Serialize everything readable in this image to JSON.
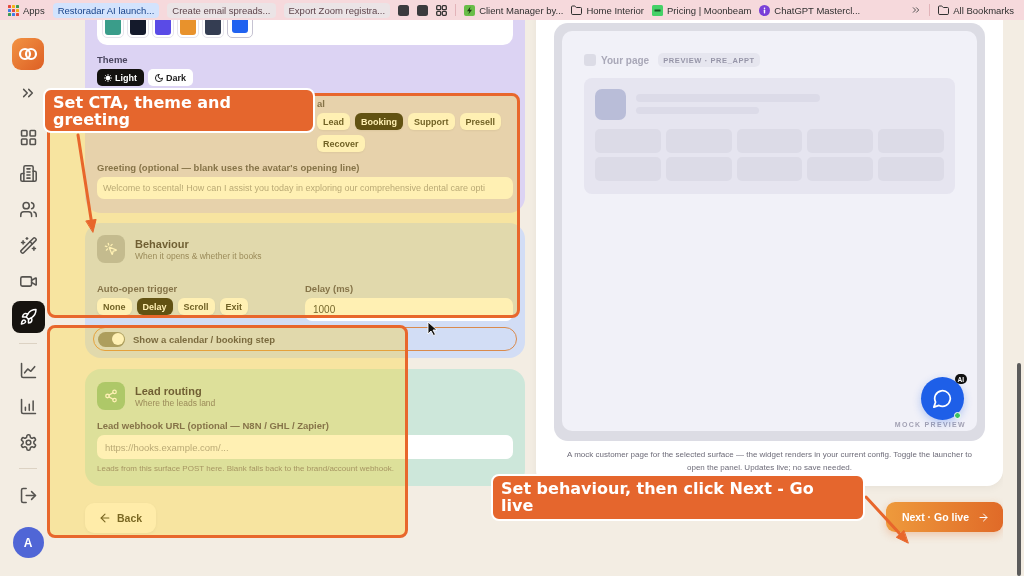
{
  "bookmarks_bar": {
    "apps_label": "Apps",
    "tab_groups": [
      {
        "label": "Restoradar AI launch...",
        "color": "#d3e3fd"
      },
      {
        "label": "Create email spreads...",
        "color": "#ebe4e6"
      },
      {
        "label": "Export Zoom registra...",
        "color": "#ebe4e6"
      }
    ],
    "bookmarks": [
      {
        "label": "Client Manager by...",
        "kind": "page"
      },
      {
        "label": "Home Interior",
        "kind": "folder"
      },
      {
        "label": "Pricing | Moonbeam",
        "kind": "page"
      },
      {
        "label": "ChatGPT Mastercl...",
        "kind": "page"
      }
    ],
    "all_bookmarks": "All Bookmarks"
  },
  "sidebar": {
    "nav_groups": [
      {
        "items": [
          {
            "selected": false
          },
          {
            "selected": false
          },
          {
            "selected": false
          },
          {
            "selected": false
          },
          {
            "selected": false
          },
          {
            "selected": true
          }
        ]
      },
      {
        "items": [
          {
            "selected": false
          },
          {
            "selected": false
          },
          {
            "selected": false
          }
        ]
      }
    ],
    "avatar_initial": "A"
  },
  "appearance_card": {
    "swatches": [
      {
        "color": "#3a9d8a",
        "selected": false
      },
      {
        "color": "#141a2b",
        "selected": false
      },
      {
        "color": "#5a4be6",
        "selected": false
      },
      {
        "color": "#e8922c",
        "selected": false
      },
      {
        "color": "#343d52",
        "selected": false
      },
      {
        "color": "#2062f0",
        "selected": true
      }
    ],
    "theme_label": "Theme",
    "themes": [
      {
        "label": "Light",
        "kind": "sun",
        "selected": true
      },
      {
        "label": "Dark",
        "kind": "moon",
        "selected": false
      }
    ],
    "goal_label": "al",
    "goals": [
      {
        "label": "Lead",
        "selected": false
      },
      {
        "label": "Booking",
        "selected": true
      },
      {
        "label": "Support",
        "selected": false
      },
      {
        "label": "Presell",
        "selected": false
      },
      {
        "label": "Recover",
        "selected": false
      }
    ],
    "greeting_label": "Greeting (optional — blank uses the avatar's opening line)",
    "greeting": {
      "placeholder": "Welcome to scental! How can I assist you today in exploring our comprehensive dental care opti"
    }
  },
  "behaviour_card": {
    "title": "Behaviour",
    "subtitle": "When it opens & whether it books",
    "trigger_label": "Auto-open trigger",
    "triggers": [
      {
        "label": "None",
        "selected": false
      },
      {
        "label": "Delay",
        "selected": true
      },
      {
        "label": "Scroll",
        "selected": false
      },
      {
        "label": "Exit",
        "selected": false
      }
    ],
    "delay_label": "Delay (ms)",
    "delay": {
      "value": "1000"
    },
    "booking_toggle": {
      "label": "Show a calendar / booking step",
      "on": true
    }
  },
  "lead_routing_card": {
    "title": "Lead routing",
    "subtitle": "Where the leads land",
    "webhook_label": "Lead webhook URL (optional — N8N / GHL / Zapier)",
    "webhook": {
      "placeholder": "https://hooks.example.com/..."
    },
    "help": "Leads from this surface POST here. Blank falls back to the brand/account webhook."
  },
  "back_button": {
    "label": "Back"
  },
  "preview": {
    "page_label": "Your page",
    "tag": "PREVIEW · PRE_APPT",
    "badge": "AI",
    "footer_label": "MOCK PREVIEW",
    "caption": "A mock customer page for the selected surface — the widget renders in your current config. Toggle the launcher to open the panel. Updates live; no save needed."
  },
  "next_button": {
    "label": "Next · Go live"
  },
  "annotations": [
    {
      "text": "Set CTA, theme and greeting"
    },
    {
      "text": "Set behaviour, then click Next - Go live"
    }
  ]
}
